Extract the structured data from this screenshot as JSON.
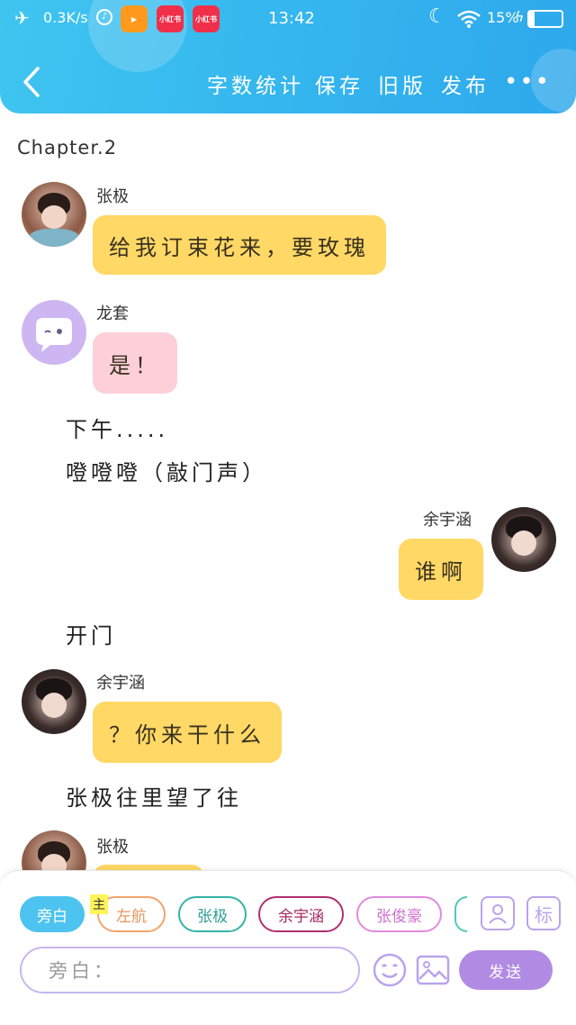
{
  "status": {
    "net_speed": "0.3K/s",
    "time": "13:42",
    "battery": "15%",
    "app1_label": "小红书",
    "app2_label": "小红书"
  },
  "nav": {
    "word_count": "字数统计",
    "save": "保存",
    "old_version": "旧版",
    "publish": "发布",
    "more": "•••"
  },
  "chapter": "Chapter.2",
  "messages": [
    {
      "name": "张极",
      "text": "给我订束花来，要玫瑰"
    },
    {
      "name": "龙套",
      "text": "是！"
    },
    {
      "name": "余宇涵",
      "text": "谁啊"
    },
    {
      "name": "余宇涵",
      "text": "？你来干什么"
    },
    {
      "name": "张极"
    }
  ],
  "narration": [
    "下午.....",
    "噔噔噔（敲门声）",
    "开门",
    "张极往里望了往"
  ],
  "composer": {
    "roles": [
      "旁白",
      "左航",
      "张极",
      "余宇涵",
      "张俊豪"
    ],
    "main_badge": "主",
    "tag_icon_label": "标",
    "placeholder": "旁白：",
    "send": "发送"
  },
  "colors": {
    "header": "#35b6ee",
    "bubble_yellow": "#ffd865",
    "bubble_pink": "#fdcfd9",
    "send_button": "#b18be3"
  }
}
